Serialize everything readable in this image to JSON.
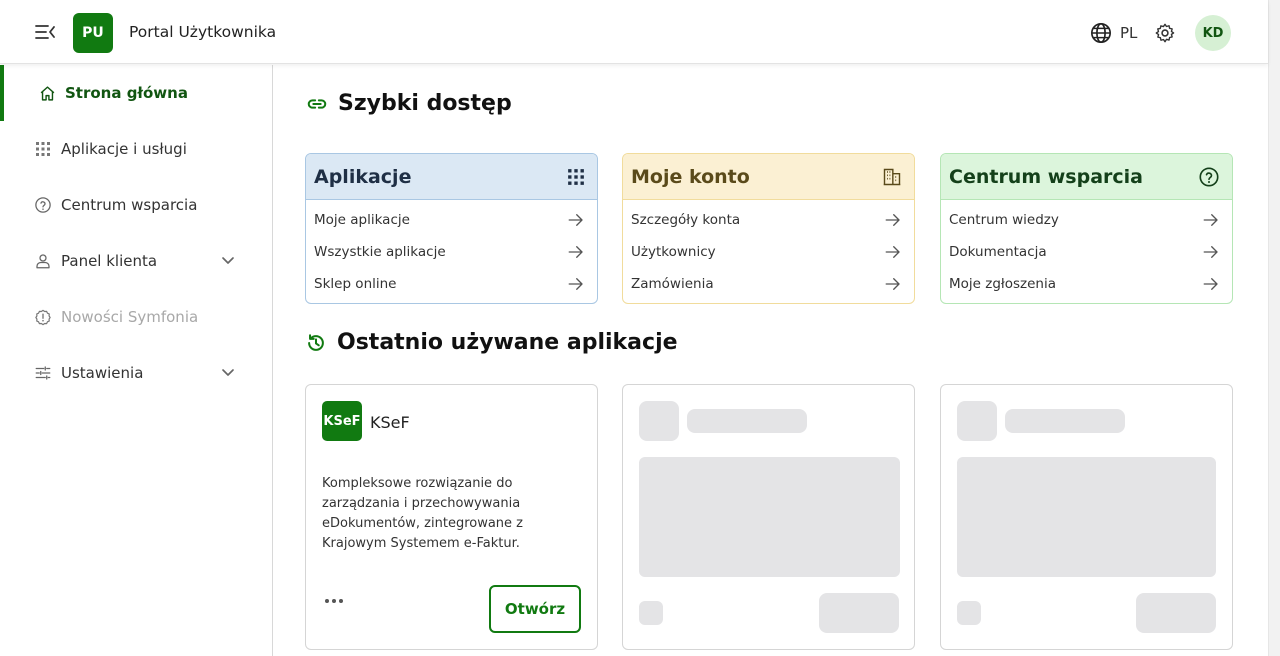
{
  "header": {
    "logo_text": "PU",
    "title": "Portal Użytkownika",
    "language": "PL",
    "avatar_initials": "KD"
  },
  "sidebar": {
    "items": [
      {
        "label": "Strona główna",
        "icon": "home-icon",
        "active": true
      },
      {
        "label": "Aplikacje i usługi",
        "icon": "grid-icon"
      },
      {
        "label": "Centrum wsparcia",
        "icon": "help-circle-icon"
      },
      {
        "label": "Panel klienta",
        "icon": "user-icon",
        "expandable": true
      },
      {
        "label": "Nowości Symfonia",
        "icon": "alert-circle-icon",
        "disabled": true
      },
      {
        "label": "Ustawienia",
        "icon": "sliders-icon",
        "expandable": true
      }
    ]
  },
  "quick_access": {
    "title": "Szybki dostęp",
    "cards": [
      {
        "title": "Aplikacje",
        "icon": "grid-icon",
        "accent": "#dbe8f4",
        "border": "#a9c7e3",
        "links": [
          "Moje aplikacje",
          "Wszystkie aplikacje",
          "Sklep online"
        ]
      },
      {
        "title": "Moje konto",
        "icon": "building-icon",
        "accent": "#fbf0d3",
        "border": "#f1dc9c",
        "links": [
          "Szczegóły konta",
          "Użytkownicy",
          "Zamówienia"
        ]
      },
      {
        "title": "Centrum wsparcia",
        "icon": "help-circle-icon",
        "accent": "#dcf5dc",
        "border": "#b5e6b5",
        "links": [
          "Centrum wiedzy",
          "Dokumentacja",
          "Moje zgłoszenia"
        ]
      }
    ]
  },
  "recent_apps": {
    "title": "Ostatnio używane aplikacje",
    "apps": [
      {
        "logo_text": "KSeF",
        "name": "KSeF",
        "description": "Kompleksowe rozwiązanie do zarządzania i przechowywania eDokumentów, zintegrowane z Krajowym Systemem e-Faktur.",
        "open_label": "Otwórz"
      }
    ]
  },
  "colors": {
    "brand": "#117a11",
    "brand_dark": "#115511"
  }
}
